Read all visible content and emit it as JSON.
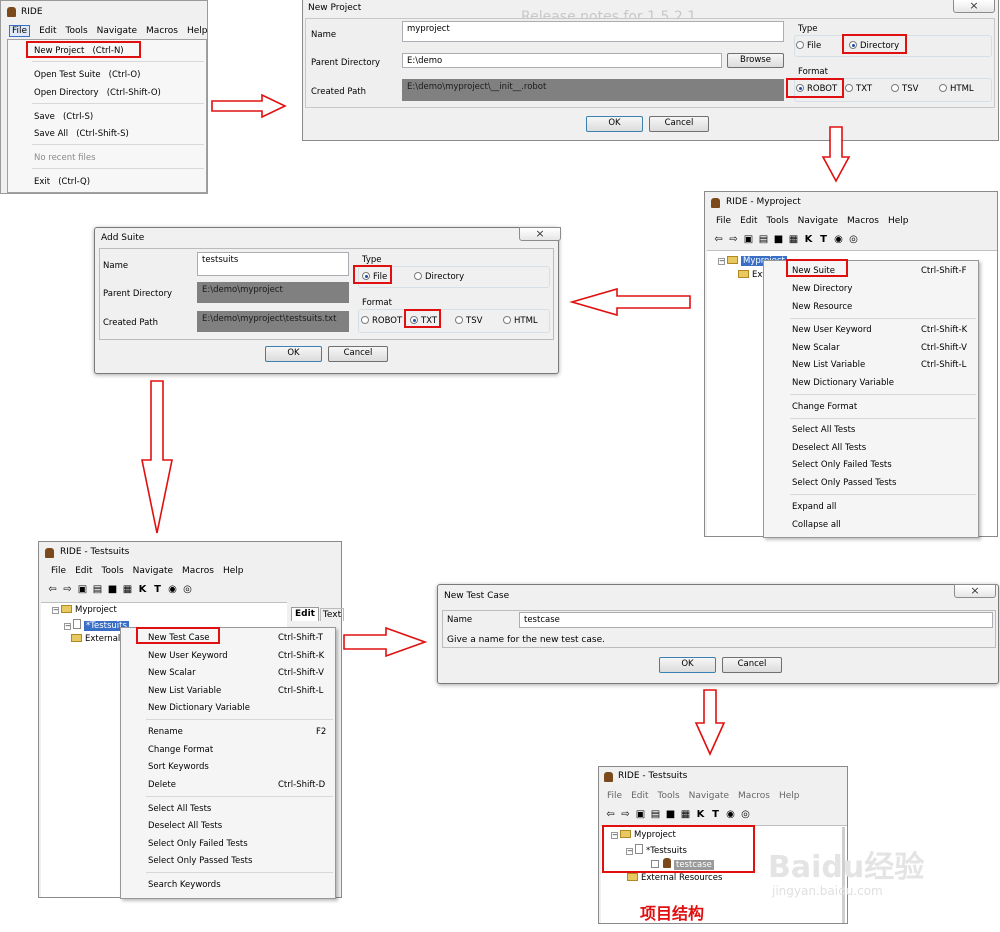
{
  "ride1": {
    "title": "RIDE",
    "menubar": [
      "File",
      "Edit",
      "Tools",
      "Navigate",
      "Macros",
      "Help"
    ],
    "file_menu": [
      {
        "label": "New Project",
        "shortcut": "(Ctrl-N)"
      },
      {
        "label": "Open Test Suite",
        "shortcut": "(Ctrl-O)"
      },
      {
        "label": "Open Directory",
        "shortcut": "(Ctrl-Shift-O)"
      },
      {
        "label": "Save",
        "shortcut": "(Ctrl-S)"
      },
      {
        "label": "Save All",
        "shortcut": "(Ctrl-Shift-S)"
      },
      {
        "label": "No recent files",
        "shortcut": ""
      },
      {
        "label": "Exit",
        "shortcut": "(Ctrl-Q)"
      }
    ]
  },
  "new_project": {
    "title": "New Project",
    "name_label": "Name",
    "name_value": "myproject",
    "parent_label": "Parent Directory",
    "parent_value": "E:\\demo",
    "browse_label": "Browse",
    "created_label": "Created Path",
    "created_value": "E:\\demo\\myproject\\__init__.robot",
    "type_label": "Type",
    "type_options": [
      "File",
      "Directory"
    ],
    "format_label": "Format",
    "format_options": [
      "ROBOT",
      "TXT",
      "TSV",
      "HTML"
    ],
    "ok_label": "OK",
    "cancel_label": "Cancel",
    "bg_text": "Release notes for 1.5.2.1"
  },
  "ride2": {
    "title": "RIDE - Myproject",
    "menubar": [
      "File",
      "Edit",
      "Tools",
      "Navigate",
      "Macros",
      "Help"
    ],
    "tree_root": "Myproject",
    "tree_ext": "Ext",
    "context_menu": [
      {
        "label": "New Suite",
        "shortcut": "Ctrl-Shift-F"
      },
      {
        "label": "New Directory",
        "shortcut": ""
      },
      {
        "label": "New Resource",
        "shortcut": ""
      },
      {
        "label": "New User Keyword",
        "shortcut": "Ctrl-Shift-K"
      },
      {
        "label": "New Scalar",
        "shortcut": "Ctrl-Shift-V"
      },
      {
        "label": "New List Variable",
        "shortcut": "Ctrl-Shift-L"
      },
      {
        "label": "New Dictionary Variable",
        "shortcut": ""
      },
      {
        "label": "Change Format",
        "shortcut": ""
      },
      {
        "label": "Select All Tests",
        "shortcut": ""
      },
      {
        "label": "Deselect All Tests",
        "shortcut": ""
      },
      {
        "label": "Select Only Failed Tests",
        "shortcut": ""
      },
      {
        "label": "Select Only Passed Tests",
        "shortcut": ""
      },
      {
        "label": "Expand all",
        "shortcut": ""
      },
      {
        "label": "Collapse all",
        "shortcut": ""
      }
    ]
  },
  "add_suite": {
    "title": "Add Suite",
    "name_label": "Name",
    "name_value": "testsuits",
    "parent_label": "Parent Directory",
    "parent_value": "E:\\demo\\myproject",
    "created_label": "Created Path",
    "created_value": "E:\\demo\\myproject\\testsuits.txt",
    "type_label": "Type",
    "type_options": [
      "File",
      "Directory"
    ],
    "format_label": "Format",
    "format_options": [
      "ROBOT",
      "TXT",
      "TSV",
      "HTML"
    ],
    "ok_label": "OK",
    "cancel_label": "Cancel"
  },
  "ride3": {
    "title": "RIDE - Testsuits",
    "menubar": [
      "File",
      "Edit",
      "Tools",
      "Navigate",
      "Macros",
      "Help"
    ],
    "tree_root": "Myproject",
    "tree_suite": "*Testsuits",
    "tree_ext": "External",
    "tabs": [
      "Edit",
      "Text"
    ],
    "context_menu": [
      {
        "label": "New Test Case",
        "shortcut": "Ctrl-Shift-T"
      },
      {
        "label": "New User Keyword",
        "shortcut": "Ctrl-Shift-K"
      },
      {
        "label": "New Scalar",
        "shortcut": "Ctrl-Shift-V"
      },
      {
        "label": "New List Variable",
        "shortcut": "Ctrl-Shift-L"
      },
      {
        "label": "New Dictionary Variable",
        "shortcut": ""
      },
      {
        "label": "Rename",
        "shortcut": "F2"
      },
      {
        "label": "Change Format",
        "shortcut": ""
      },
      {
        "label": "Sort Keywords",
        "shortcut": ""
      },
      {
        "label": "Delete",
        "shortcut": "Ctrl-Shift-D"
      },
      {
        "label": "Select All Tests",
        "shortcut": ""
      },
      {
        "label": "Deselect All Tests",
        "shortcut": ""
      },
      {
        "label": "Select Only Failed Tests",
        "shortcut": ""
      },
      {
        "label": "Select Only Passed Tests",
        "shortcut": ""
      },
      {
        "label": "Search Keywords",
        "shortcut": ""
      }
    ]
  },
  "new_test_case": {
    "title": "New Test Case",
    "name_label": "Name",
    "name_value": "testcase",
    "hint": "Give a name for the new test case.",
    "ok_label": "OK",
    "cancel_label": "Cancel"
  },
  "ride4": {
    "title": "RIDE - Testsuits",
    "menubar": [
      "File",
      "Edit",
      "Tools",
      "Navigate",
      "Macros",
      "Help"
    ],
    "tree_root": "Myproject",
    "tree_suite": "*Testsuits",
    "tree_case": "testcase",
    "tree_ext": "External Resources",
    "caption": "项目结构"
  },
  "watermark": {
    "brand": "Baidu经验",
    "url": "jingyan.baidu.com"
  },
  "colors": {
    "highlight": "#e01010",
    "arrow": "#e01010",
    "selection": "#3a6fc8"
  }
}
